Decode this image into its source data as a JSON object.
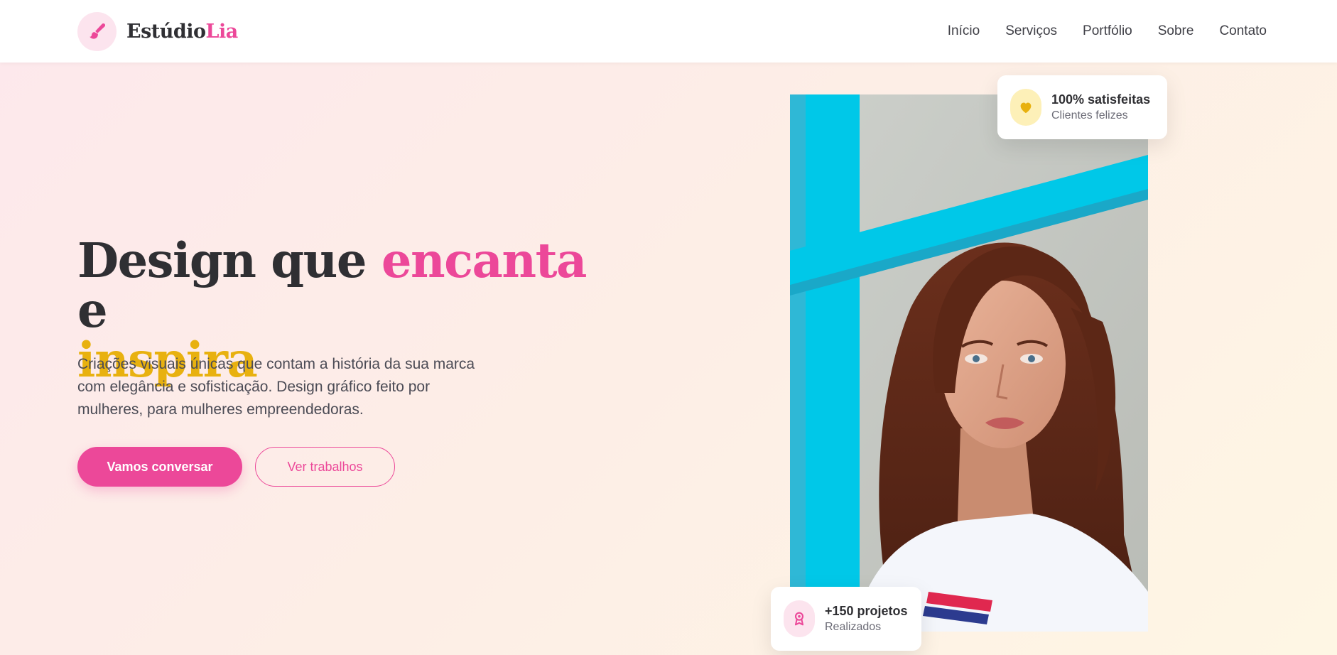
{
  "brand": {
    "name_main": "Estúdio",
    "name_accent": "Lia",
    "logo_icon": "paintbrush-icon"
  },
  "nav": {
    "items": [
      {
        "label": "Início"
      },
      {
        "label": "Serviços"
      },
      {
        "label": "Portfólio"
      },
      {
        "label": "Sobre"
      },
      {
        "label": "Contato"
      }
    ]
  },
  "hero": {
    "title_part1": "Design que ",
    "title_highlight1": "encanta",
    "title_part2": " e ",
    "title_highlight2": "inspira",
    "description": "Criações visuais únicas que contam a história da sua marca com elegância e sofisticação. Design gráfico feito por mulheres, para mulheres empreendedoras.",
    "primary_button": "Vamos conversar",
    "secondary_button": "Ver trabalhos"
  },
  "stats": {
    "satisfaction": {
      "title": "100% satisfeitas",
      "subtitle": "Clientes felizes",
      "icon": "heart-icon"
    },
    "projects": {
      "title": "+150 projetos",
      "subtitle": "Realizados",
      "icon": "award-icon"
    }
  },
  "colors": {
    "accent_pink": "#ec4899",
    "accent_gold": "#e8b10f",
    "heading": "#2f2f33",
    "photo_frame_cyan": "#00c8e8"
  }
}
